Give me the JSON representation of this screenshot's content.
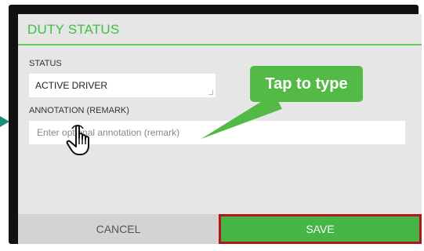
{
  "dialog": {
    "title": "DUTY STATUS"
  },
  "status": {
    "label": "STATUS",
    "value": "ACTIVE DRIVER"
  },
  "annotation": {
    "label": "ANNOTATION (REMARK)",
    "placeholder": "Enter optional annotation (remark)",
    "value": ""
  },
  "callout": {
    "text": "Tap to type"
  },
  "footer": {
    "cancel_label": "CANCEL",
    "save_label": "SAVE"
  },
  "colors": {
    "accent": "#3fbf3f",
    "save_background": "#45b645",
    "save_highlight_border": "#b3151b",
    "callout_background": "#53b947",
    "pointer_arrow": "#1a8f7c"
  },
  "icons": {
    "pointer": "arrow-right-icon",
    "hand": "tap-hand-icon"
  }
}
